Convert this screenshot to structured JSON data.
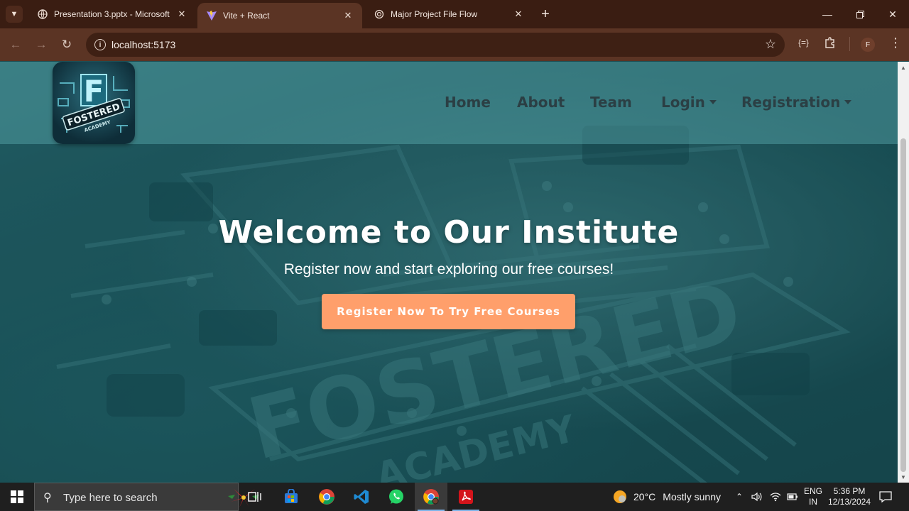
{
  "browser": {
    "tabs": [
      {
        "title": "Presentation 3.pptx - Microsoft",
        "icon": "globe-icon",
        "active": false
      },
      {
        "title": "Vite + React",
        "icon": "vite-icon",
        "active": true
      },
      {
        "title": "Major Project File Flow",
        "icon": "openai-icon",
        "active": false
      }
    ],
    "url": "localhost:5173",
    "profile_initial": "F",
    "debug_label": "{=}"
  },
  "site": {
    "nav": {
      "home": "Home",
      "about": "About",
      "team": "Team",
      "login": "Login",
      "registration": "Registration"
    },
    "logo": {
      "letter": "F",
      "name": "FOSTERED",
      "tagline": "ACADEMY"
    },
    "hero": {
      "title": "Welcome to Our Institute",
      "subtitle": "Register now and start exploring our free courses!",
      "cta": "Register Now To Try Free Courses"
    },
    "colors": {
      "accent": "#ff9f6b",
      "nav_text": "#2b3f44",
      "background": "#1d555b"
    }
  },
  "taskbar": {
    "search_placeholder": "Type here to search",
    "apps": [
      "task-view-icon",
      "store-icon",
      "chrome-icon",
      "vscode-icon",
      "whatsapp-icon",
      "chrome-icon",
      "acrobat-icon"
    ],
    "weather": {
      "temp": "20°C",
      "condition": "Mostly sunny"
    },
    "lang": {
      "line1": "ENG",
      "line2": "IN"
    },
    "time": "5:36 PM",
    "date": "12/13/2024"
  }
}
